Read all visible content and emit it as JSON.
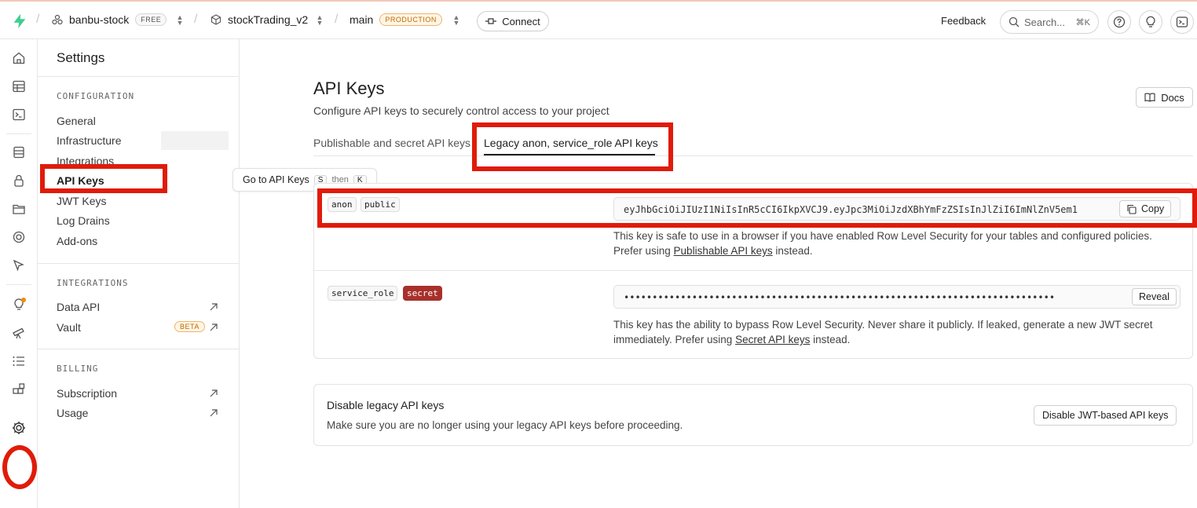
{
  "topbar": {
    "org_name": "banbu-stock",
    "org_plan": "FREE",
    "project_name": "stockTrading_v2",
    "branch_name": "main",
    "branch_env": "PRODUCTION",
    "connect_label": "Connect",
    "feedback_label": "Feedback",
    "search_placeholder": "Search...",
    "search_shortcut": "⌘K"
  },
  "sidebar": {
    "title": "Settings",
    "sections": [
      {
        "heading": "CONFIGURATION",
        "items": [
          "General",
          "Infrastructure",
          "Integrations",
          "API Keys",
          "JWT Keys",
          "Log Drains",
          "Add-ons"
        ]
      },
      {
        "heading": "INTEGRATIONS",
        "items": [
          "Data API",
          "Vault"
        ]
      },
      {
        "heading": "BILLING",
        "items": [
          "Subscription",
          "Usage"
        ]
      }
    ],
    "active_item": "API Keys",
    "vault_badge": "BETA"
  },
  "tooltip": {
    "label": "Go to API Keys",
    "key1": "S",
    "then": "then",
    "key2": "K"
  },
  "main": {
    "title": "API Keys",
    "subtitle": "Configure API keys to securely control access to your project",
    "docs_label": "Docs",
    "tabs": [
      {
        "label": "Publishable and secret API keys",
        "active": false
      },
      {
        "label": "Legacy anon, service_role API keys",
        "active": true
      }
    ],
    "keys": [
      {
        "name": "anon",
        "tag": "public",
        "value": "eyJhbGciOiJIUzI1NiIsInR5cCI6IkpXVCJ9.eyJpc3MiOiJzdXBhYmFzZSIsInJlZiI6ImNlZnV5em1",
        "button": "Copy",
        "desc_1": "This key is safe to use in a browser if you have enabled Row Level Security for your tables and configured policies.",
        "desc_2_pre": "Prefer using ",
        "desc_2_link": "Publishable API keys",
        "desc_2_post": " instead."
      },
      {
        "name": "service_role",
        "tag": "secret",
        "value": "••••••••••••••••••••••••••••••••••••••••••••••••••••••••••••••••••••••••••••",
        "button": "Reveal",
        "desc_1": "This key has the ability to bypass Row Level Security. Never share it publicly. If leaked, generate a new JWT secret",
        "desc_2_pre": "immediately. Prefer using ",
        "desc_2_link": "Secret API keys",
        "desc_2_post": " instead."
      }
    ],
    "disable": {
      "title": "Disable legacy API keys",
      "subtitle": "Make sure you are no longer using your legacy API keys before proceeding.",
      "button": "Disable JWT-based API keys"
    }
  },
  "colors": {
    "brand": "#3ecf8e",
    "highlight": "#e01b0a",
    "secret_tag": "#a8302b"
  }
}
